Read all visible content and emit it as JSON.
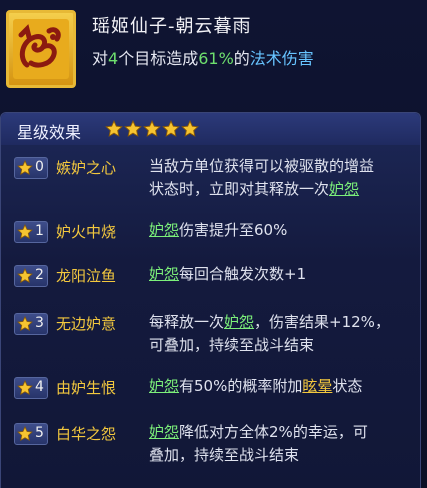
{
  "skill": {
    "title": "瑶姬仙子-朝云暮雨",
    "desc_prefix": "对",
    "desc_targets": "4",
    "desc_mid": "个目标造成",
    "desc_percent": "61%",
    "desc_of": "的",
    "desc_type": "法术伤害"
  },
  "stars_section": {
    "title": "星级效果",
    "star_count": 5
  },
  "rows": [
    {
      "level": "0",
      "name": "嫉妒之心",
      "line1": [
        {
          "t": "当敌方单位获得可以被驱散的增益"
        }
      ],
      "line2": [
        {
          "t": "状态时，立即对其释放一次"
        },
        {
          "t": "妒怨",
          "k": "green"
        }
      ]
    },
    {
      "level": "1",
      "name": "妒火中烧",
      "line1": [
        {
          "t": "妒怨",
          "k": "green"
        },
        {
          "t": "伤害提升至60%"
        }
      ],
      "line2": []
    },
    {
      "level": "2",
      "name": "龙阳泣鱼",
      "line1": [
        {
          "t": "妒怨",
          "k": "green"
        },
        {
          "t": "每回合触发次数+1"
        }
      ],
      "line2": []
    },
    {
      "level": "3",
      "name": "无边妒意",
      "line1": [
        {
          "t": "每释放一次"
        },
        {
          "t": "妒怨",
          "k": "green"
        },
        {
          "t": "，伤害结果+12%，"
        }
      ],
      "line2": [
        {
          "t": "可叠加，持续至战斗结束"
        }
      ]
    },
    {
      "level": "4",
      "name": "由妒生恨",
      "line1": [
        {
          "t": "妒怨",
          "k": "green"
        },
        {
          "t": "有50%的概率附加"
        },
        {
          "t": "眩晕",
          "k": "yellow"
        },
        {
          "t": "状态"
        }
      ],
      "line2": []
    },
    {
      "level": "5",
      "name": "白华之怨",
      "line1": [
        {
          "t": "妒怨",
          "k": "green"
        },
        {
          "t": "降低对方全体2%的幸运，可"
        }
      ],
      "line2": [
        {
          "t": "叠加，持续至战斗结束"
        }
      ]
    }
  ],
  "colors": {
    "accent_gold": "#f3c83e",
    "keyword_green": "#7cf07a",
    "number_green": "#6ee06e",
    "damage_blue": "#67c4ff"
  },
  "icons": {
    "skill": "dragon-emblem-icon",
    "star": "star-icon"
  }
}
